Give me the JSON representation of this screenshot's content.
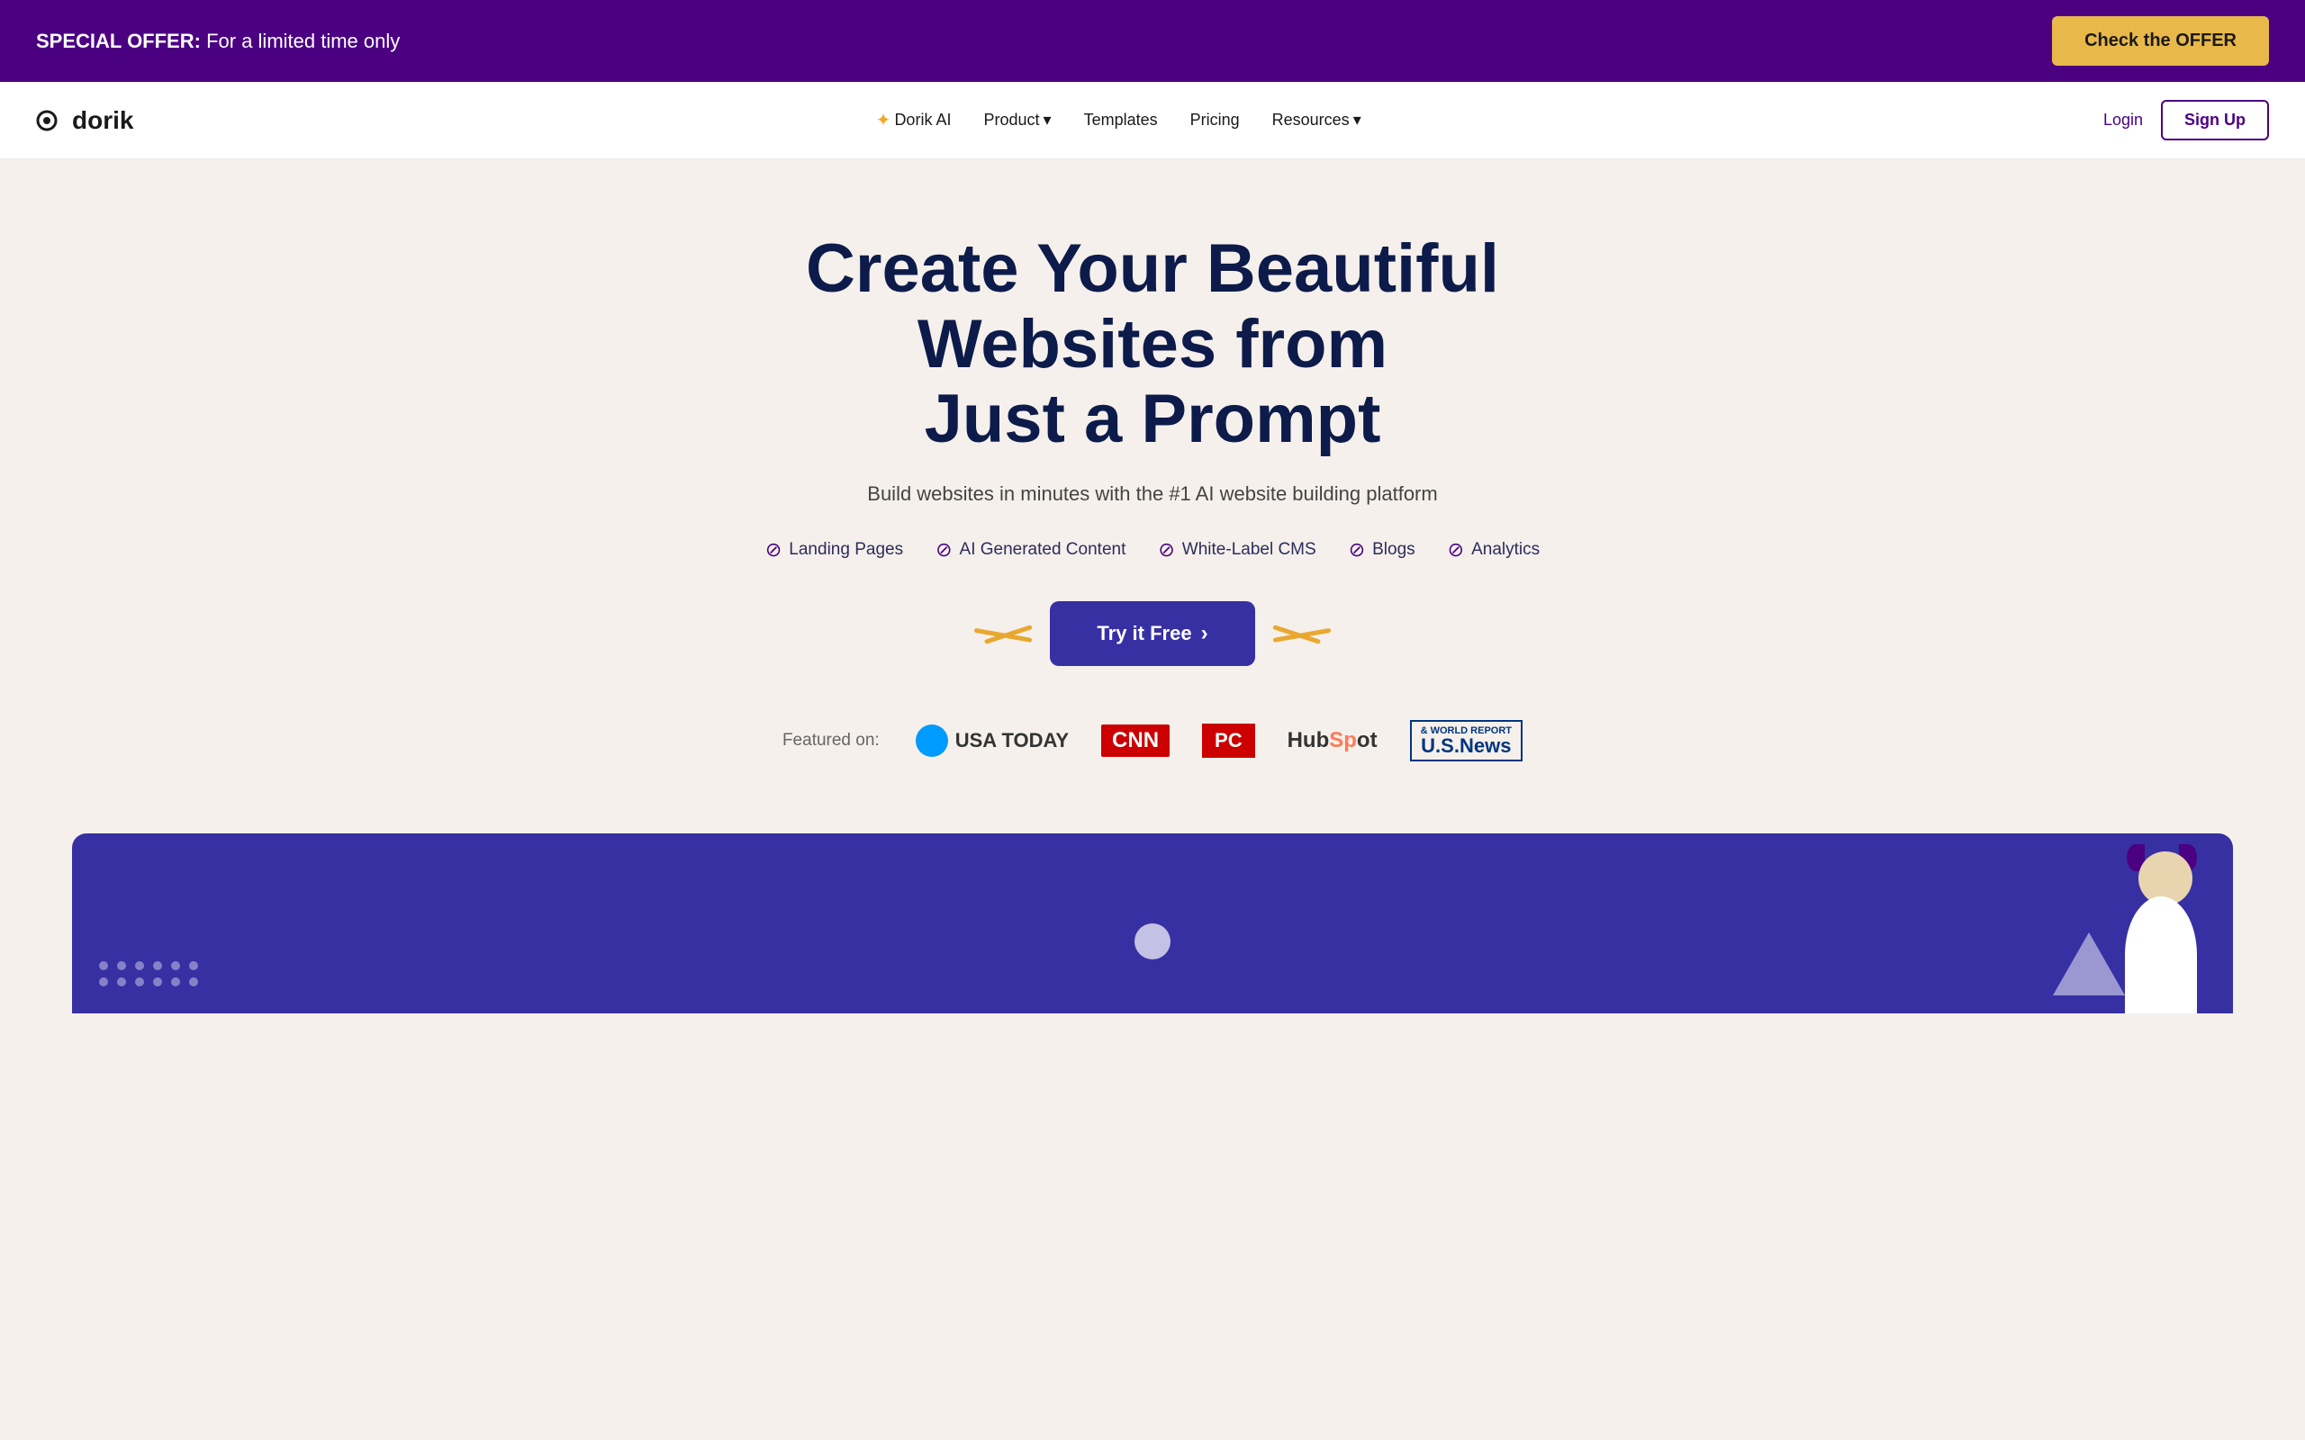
{
  "announcement": {
    "bold_text": "SPECIAL OFFER:",
    "text": " For a limited time only",
    "cta_label": "Check the OFFER"
  },
  "nav": {
    "logo": "dorik",
    "links": [
      {
        "id": "dorik-ai",
        "label": "Dorik AI",
        "has_icon": true,
        "has_arrow": false
      },
      {
        "id": "product",
        "label": "Product",
        "has_icon": false,
        "has_arrow": true
      },
      {
        "id": "templates",
        "label": "Templates",
        "has_icon": false,
        "has_arrow": false
      },
      {
        "id": "pricing",
        "label": "Pricing",
        "has_icon": false,
        "has_arrow": false
      },
      {
        "id": "resources",
        "label": "Resources",
        "has_icon": false,
        "has_arrow": true
      }
    ],
    "login_label": "Login",
    "signup_label": "Sign Up"
  },
  "hero": {
    "title_line1": "Create Your Beautiful Websites from",
    "title_line2": "Just a Prompt",
    "subtitle": "Build websites in minutes with the #1 AI website building platform",
    "features": [
      {
        "id": "landing-pages",
        "label": "Landing Pages"
      },
      {
        "id": "ai-content",
        "label": "AI Generated Content"
      },
      {
        "id": "white-label",
        "label": "White-Label CMS"
      },
      {
        "id": "blogs",
        "label": "Blogs"
      },
      {
        "id": "analytics",
        "label": "Analytics"
      }
    ],
    "cta_label": "Try it Free",
    "cta_arrow": "›"
  },
  "featured": {
    "label": "Featured on:",
    "logos": [
      {
        "id": "usa-today",
        "text": "USA TODAY"
      },
      {
        "id": "cnn",
        "text": "CNN"
      },
      {
        "id": "pc",
        "text": "PC"
      },
      {
        "id": "hubspot",
        "text": "HubSpot"
      },
      {
        "id": "usnews",
        "text": "U.S.News",
        "sub": "& WORLD REPORT"
      }
    ]
  },
  "colors": {
    "purple_dark": "#3730a3",
    "purple_brand": "#4b0082",
    "gold": "#e8a830",
    "hero_bg": "#f5f0eb",
    "announcement_bg": "#4b0082"
  }
}
